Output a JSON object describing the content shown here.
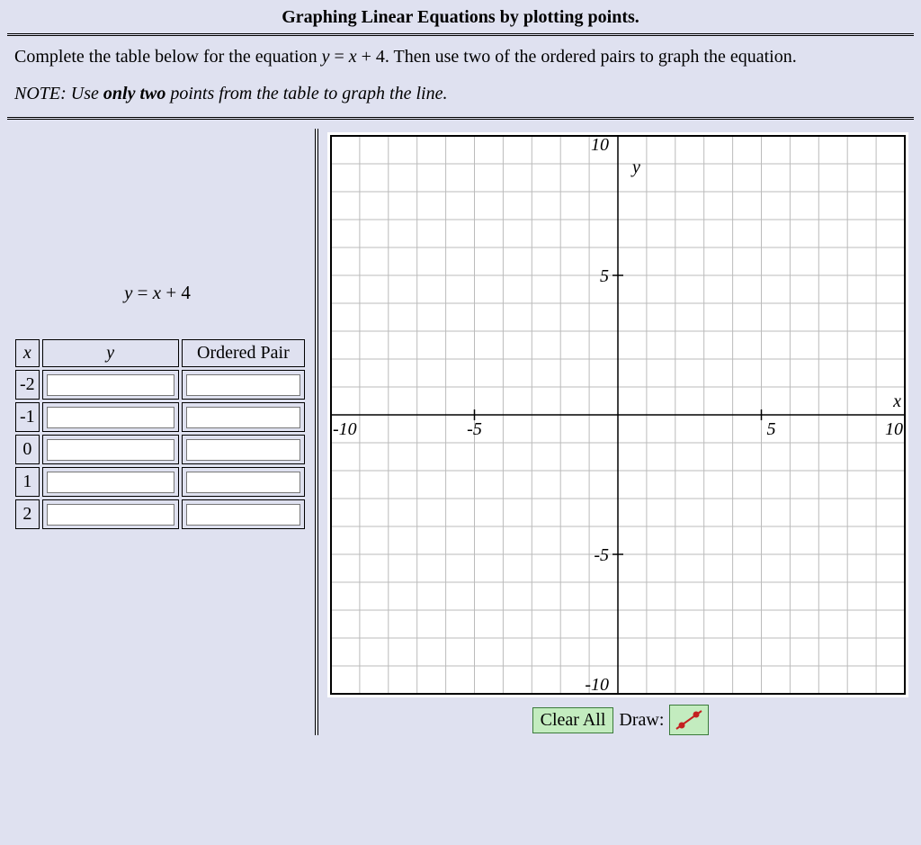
{
  "title": "Graphing Linear Equations by plotting points.",
  "instructions": "Complete the table below for the equation y = x + 4. Then use two of the ordered pairs to graph the equation.",
  "note_prefix": "NOTE: Use ",
  "note_bold": "only two",
  "note_suffix": " points from the table to graph the line.",
  "equation": "y = x + 4",
  "table": {
    "headers": {
      "x": "x",
      "y": "y",
      "op": "Ordered Pair"
    },
    "rows": [
      {
        "x": "-2",
        "y": "",
        "op": ""
      },
      {
        "x": "-1",
        "y": "",
        "op": ""
      },
      {
        "x": "0",
        "y": "",
        "op": ""
      },
      {
        "x": "1",
        "y": "",
        "op": ""
      },
      {
        "x": "2",
        "y": "",
        "op": ""
      }
    ]
  },
  "chart_data": {
    "type": "scatter",
    "title": "",
    "xlabel": "x",
    "ylabel": "y",
    "xlim": [
      -10,
      10
    ],
    "ylim": [
      -10,
      10
    ],
    "xticks": [
      -10,
      -5,
      5,
      10
    ],
    "yticks": [
      -10,
      -5,
      5,
      10
    ],
    "grid": true,
    "series": []
  },
  "toolbar": {
    "clear_label": "Clear All",
    "draw_label": "Draw:"
  }
}
